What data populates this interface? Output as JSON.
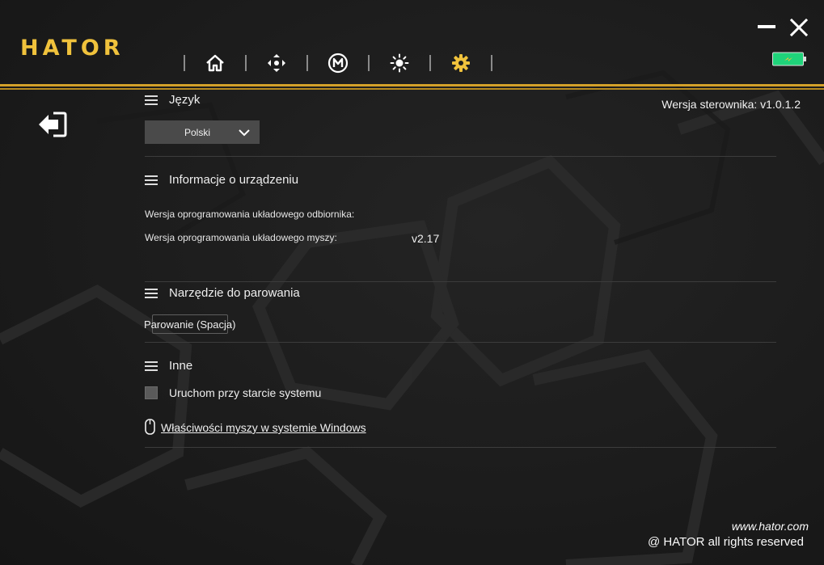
{
  "app": {
    "logo": "HATOR",
    "accent_color": "#d4a12a"
  },
  "nav": {
    "items": [
      {
        "icon": "home-icon"
      },
      {
        "icon": "move-arrows-icon"
      },
      {
        "icon": "macro-m-icon"
      },
      {
        "icon": "brightness-icon"
      },
      {
        "icon": "gear-icon",
        "active": true
      }
    ]
  },
  "window": {
    "battery_color": "#1fd37a"
  },
  "driver_version": "Wersja sterownika: v1.0.1.2",
  "language": {
    "title": "Język",
    "selected": "Polski"
  },
  "device_info": {
    "title": "Informacje o urządzeniu",
    "receiver_firmware_label": "Wersja oprogramowania układowego odbiornika:",
    "receiver_firmware_value": "",
    "mouse_firmware_label": "Wersja oprogramowania układowego myszy:",
    "mouse_firmware_value": "v2.17"
  },
  "pairing": {
    "title": "Narzędzie do parowania",
    "button_label": "Parowanie (Spacja)"
  },
  "other": {
    "title": "Inne",
    "autostart_label": "Uruchom przy starcie systemu",
    "autostart_checked": false,
    "mouse_properties_link": "Właściwości myszy w systemie Windows"
  },
  "footer": {
    "site": "www.hator.com",
    "copyright": "@ HATOR all rights reserved"
  }
}
